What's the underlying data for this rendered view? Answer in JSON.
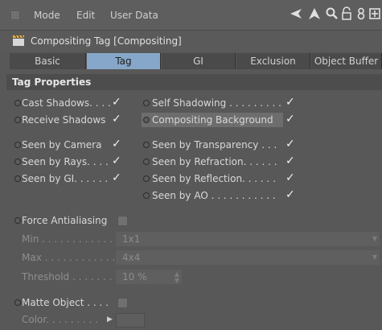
{
  "menubar": {
    "items": [
      "Mode",
      "Edit",
      "User Data"
    ],
    "icons": [
      "back-arrow-icon",
      "forward-arrow-icon",
      "search-icon",
      "lock-icon",
      "link-icon",
      "new-panel-icon"
    ]
  },
  "title": "Compositing Tag [Compositing]",
  "tabs": [
    "Basic",
    "Tag",
    "GI",
    "Exclusion",
    "Object Buffer"
  ],
  "active_tab": "Tag",
  "section": "Tag Properties",
  "left_options": [
    {
      "label": "Cast Shadows. . . .",
      "checked": true
    },
    {
      "label": "Receive Shadows",
      "checked": true
    },
    {
      "label": "Seen by Camera",
      "checked": true
    },
    {
      "label": "Seen by Rays. . . .",
      "checked": true
    },
    {
      "label": "Seen by GI. . . . . .",
      "checked": true
    }
  ],
  "right_options": [
    {
      "label": "Self Shadowing . . . . . . . . .",
      "checked": true
    },
    {
      "label": "Compositing Background",
      "checked": true
    },
    {
      "label": "Seen by Transparency . . .",
      "checked": true
    },
    {
      "label": "Seen by Refraction. . . . . .",
      "checked": true
    },
    {
      "label": "Seen by Reflection. . . . . .",
      "checked": true
    },
    {
      "label": "Seen by AO . . . . . . . . . . .",
      "checked": true
    }
  ],
  "force_aa": {
    "label": "Force Antialiasing",
    "checked": false
  },
  "min": {
    "label": "Min . . . . . . . . . . . .",
    "value": "1x1"
  },
  "max": {
    "label": "Max . . . . . . . . . . . .",
    "value": "4x4"
  },
  "threshold": {
    "label": "Threshold . . . . . . .",
    "value": "10 %"
  },
  "matte": {
    "label": "Matte Object . . . .",
    "checked": false
  },
  "color": {
    "label": "Color. . . . . . . . ."
  },
  "check_glyph": "✓",
  "colors": {
    "active_tab": "#86a7c9",
    "background": "#585858"
  }
}
